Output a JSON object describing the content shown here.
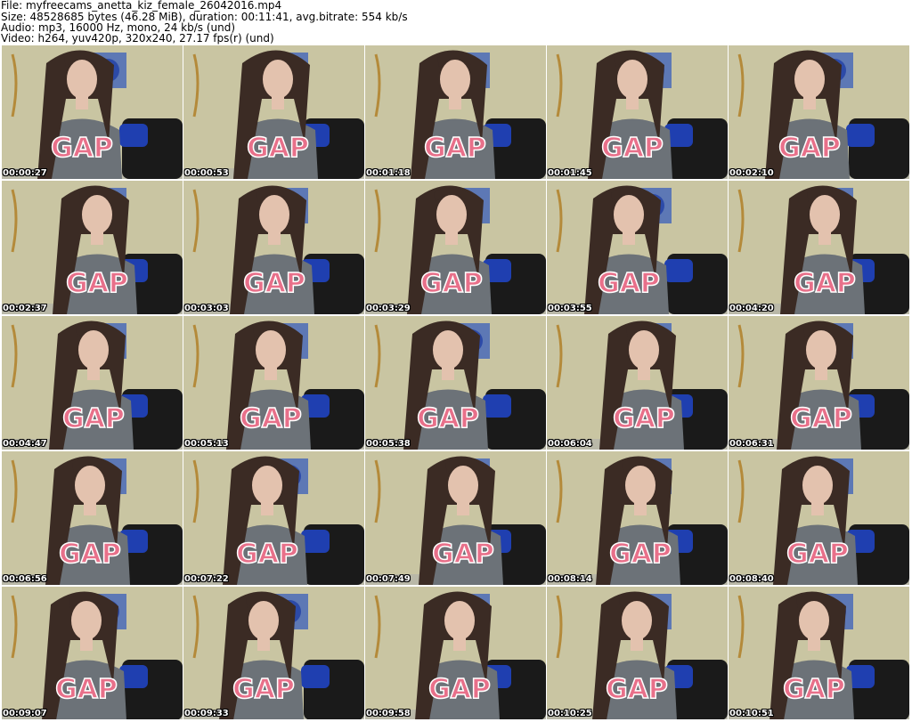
{
  "header": {
    "file_line": "File: myfreecams_anetta_kiz_female_26042016.mp4",
    "size_line": "Size: 48528685 bytes (46.28 MiB), duration: 00:11:41, avg.bitrate: 554 kb/s",
    "audio_line": "Audio: mp3, 16000 Hz, mono, 24 kb/s (und)",
    "video_line": "Video: h264, yuv420p, 320x240, 27.17 fps(r) (und)"
  },
  "shirt_text": "GAP",
  "colors": {
    "wall": "#c9c5a2",
    "shirt": "#6c7278",
    "shirt_logo": "#e8708a",
    "hair": "#3b2b24",
    "skin": "#e3c2ae",
    "chair": "#1a1a1a",
    "pillow": "#1f3fb0",
    "frame": "#4a6ab8"
  },
  "thumbnails": [
    {
      "timestamp": "00:00:27"
    },
    {
      "timestamp": "00:00:53"
    },
    {
      "timestamp": "00:01:18"
    },
    {
      "timestamp": "00:01:45"
    },
    {
      "timestamp": "00:02:10"
    },
    {
      "timestamp": "00:02:37"
    },
    {
      "timestamp": "00:03:03"
    },
    {
      "timestamp": "00:03:29"
    },
    {
      "timestamp": "00:03:55"
    },
    {
      "timestamp": "00:04:20"
    },
    {
      "timestamp": "00:04:47"
    },
    {
      "timestamp": "00:05:13"
    },
    {
      "timestamp": "00:05:38"
    },
    {
      "timestamp": "00:06:04"
    },
    {
      "timestamp": "00:06:31"
    },
    {
      "timestamp": "00:06:56"
    },
    {
      "timestamp": "00:07:22"
    },
    {
      "timestamp": "00:07:49"
    },
    {
      "timestamp": "00:08:14"
    },
    {
      "timestamp": "00:08:40"
    },
    {
      "timestamp": "00:09:07"
    },
    {
      "timestamp": "00:09:33"
    },
    {
      "timestamp": "00:09:58"
    },
    {
      "timestamp": "00:10:25"
    },
    {
      "timestamp": "00:10:51"
    }
  ]
}
